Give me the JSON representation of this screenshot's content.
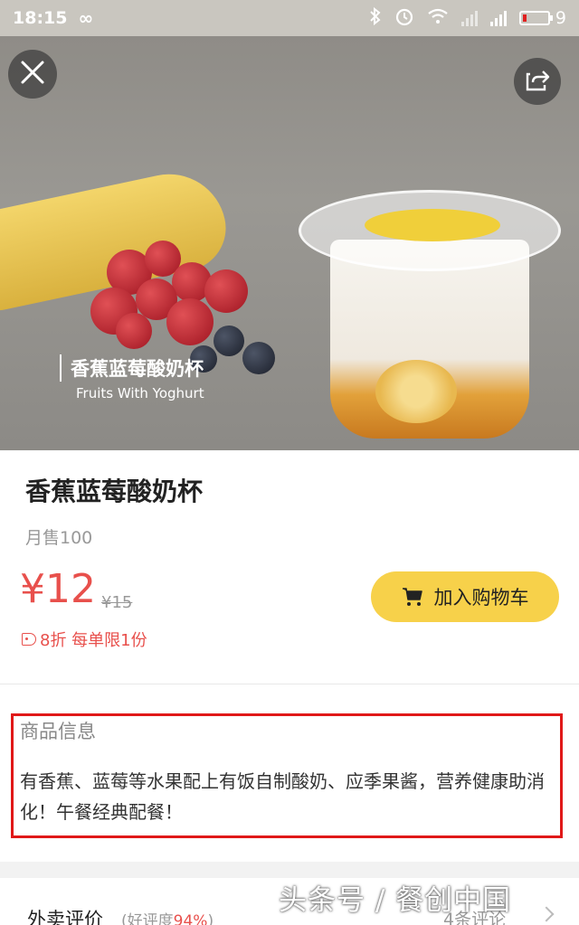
{
  "status_bar": {
    "time": "18:15",
    "loop_glyph": "∞",
    "battery_level": "9",
    "icons": [
      "bluetooth-icon",
      "alarm-icon",
      "wifi-icon",
      "signal-icon",
      "4g-signal-icon",
      "battery-icon"
    ]
  },
  "hero": {
    "caption_zh": "香蕉蓝莓酸奶杯",
    "caption_en": "Fruits With Yoghurt",
    "close_icon": "close-icon",
    "share_icon": "share-icon"
  },
  "product": {
    "name": "香蕉蓝莓酸奶杯",
    "monthly_sales": "月售100",
    "price": "¥12",
    "original_price": "¥15",
    "discount_text": "8折 每单限1份",
    "add_to_cart_label": "加入购物车"
  },
  "info": {
    "title": "商品信息",
    "description": "有香蕉、蓝莓等水果配上有饭自制酸奶、应季果酱，营养健康助消化！午餐经典配餐！"
  },
  "reviews": {
    "title": "外卖评价",
    "rating_prefix": "(好评度",
    "rating_value": "94%",
    "rating_suffix": ")",
    "count": "4条评论"
  },
  "watermark": "头条号 / 餐创中国",
  "colors": {
    "price_red": "#e8504c",
    "cart_button": "#f7d14a",
    "highlight_box": "#e01818",
    "status_bar": "#c9c6bf"
  }
}
